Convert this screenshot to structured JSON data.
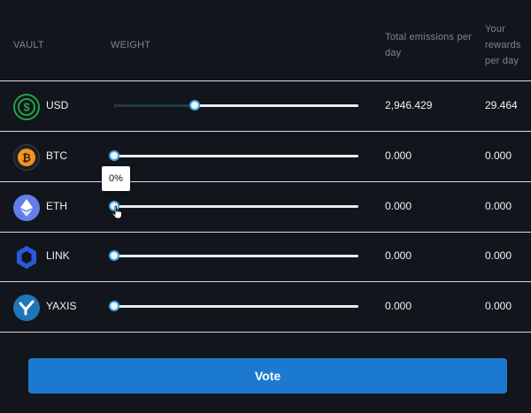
{
  "header": {
    "vault": "VAULT",
    "weight": "WEIGHT",
    "emissions": "Total emissions per day",
    "rewards": "Your rewards per day"
  },
  "rows": [
    {
      "name": "USD",
      "icon": "dollar-coin-icon",
      "weight": 0.33,
      "emissions": "2,946.429",
      "rewards": "29.464"
    },
    {
      "name": "BTC",
      "icon": "bitcoin-icon",
      "weight": 0,
      "emissions": "0.000",
      "rewards": "0.000"
    },
    {
      "name": "ETH",
      "icon": "ethereum-icon",
      "weight": 0,
      "emissions": "0.000",
      "rewards": "0.000"
    },
    {
      "name": "LINK",
      "icon": "chainlink-icon",
      "weight": 0,
      "emissions": "0.000",
      "rewards": "0.000"
    },
    {
      "name": "YAXIS",
      "icon": "yaxis-icon",
      "weight": 0,
      "emissions": "0.000",
      "rewards": "0.000"
    }
  ],
  "tooltip": "0%",
  "vote_label": "Vote",
  "colors": {
    "background": "#12151b",
    "accent": "#1b7ad0",
    "slider_thumb_border": "#3ea7e8"
  }
}
